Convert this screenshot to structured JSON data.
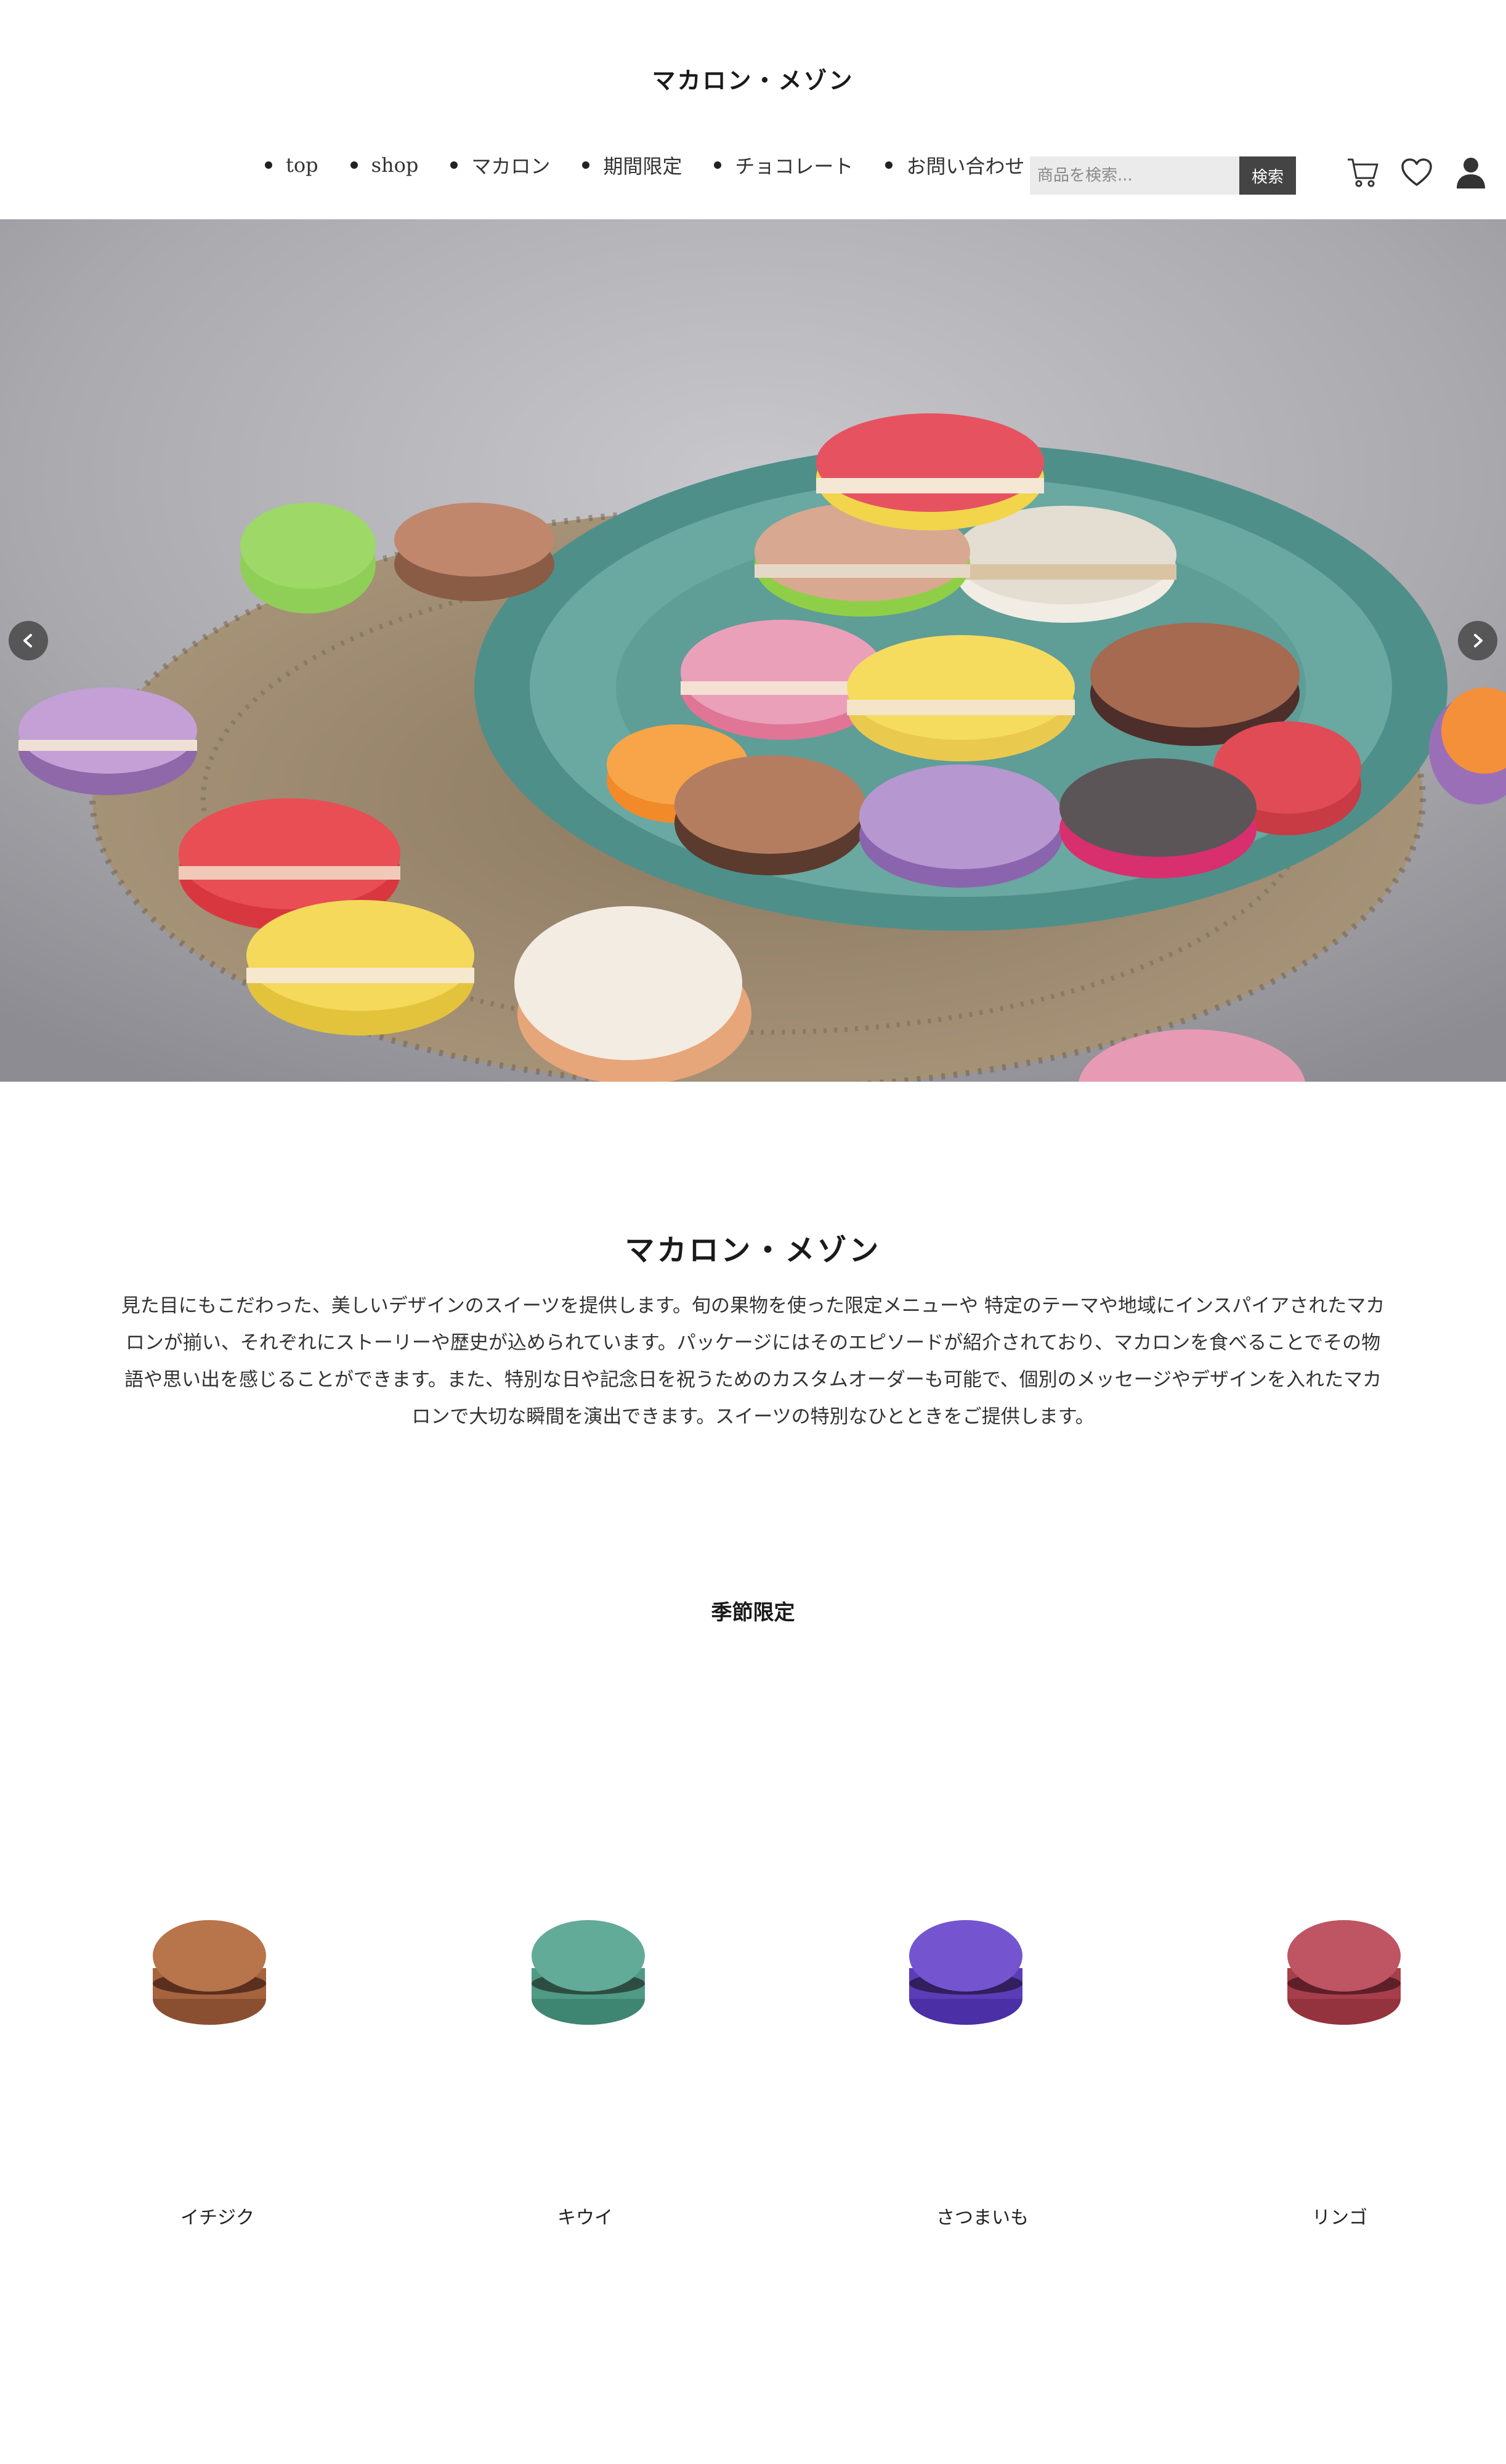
{
  "header": {
    "site_title": "マカロン・メゾン",
    "nav": [
      "top",
      "shop",
      "マカロン",
      "期間限定",
      "チョコレート",
      "お問い合わせ"
    ],
    "search_placeholder": "商品を検索...",
    "search_button": "検索",
    "icons": [
      "cart-icon",
      "heart-icon",
      "user-icon"
    ]
  },
  "hero": {
    "prev_icon": "chevron-left-icon",
    "next_icon": "chevron-right-icon"
  },
  "about": {
    "title": "マカロン・メゾン",
    "text": "見た目にもこだわった、美しいデザインのスイーツを提供します。旬の果物を使った限定メニューや 特定のテーマや地域にインスパイアされたマカロンが揃い、それぞれにストーリーや歴史が込められています。パッケージにはそのエピソードが紹介されており、マカロンを食べることでその物語や思い出を感じることができます。また、特別な日や記念日を祝うためのカスタムオーダーも可能で、個別のメッセージやデザインを入れたマカロンで大切な瞬間を演出できます。スイーツの特別なひとときをご提供します。"
  },
  "seasonal": {
    "title": "季節限定",
    "products": [
      {
        "name": "イチジク",
        "color": "#a8673f"
      },
      {
        "name": "キウイ",
        "color": "#5aa28e"
      },
      {
        "name": "さつまいも",
        "color": "#6a4cc4"
      },
      {
        "name": "リンゴ",
        "color": "#b34a57"
      }
    ]
  }
}
